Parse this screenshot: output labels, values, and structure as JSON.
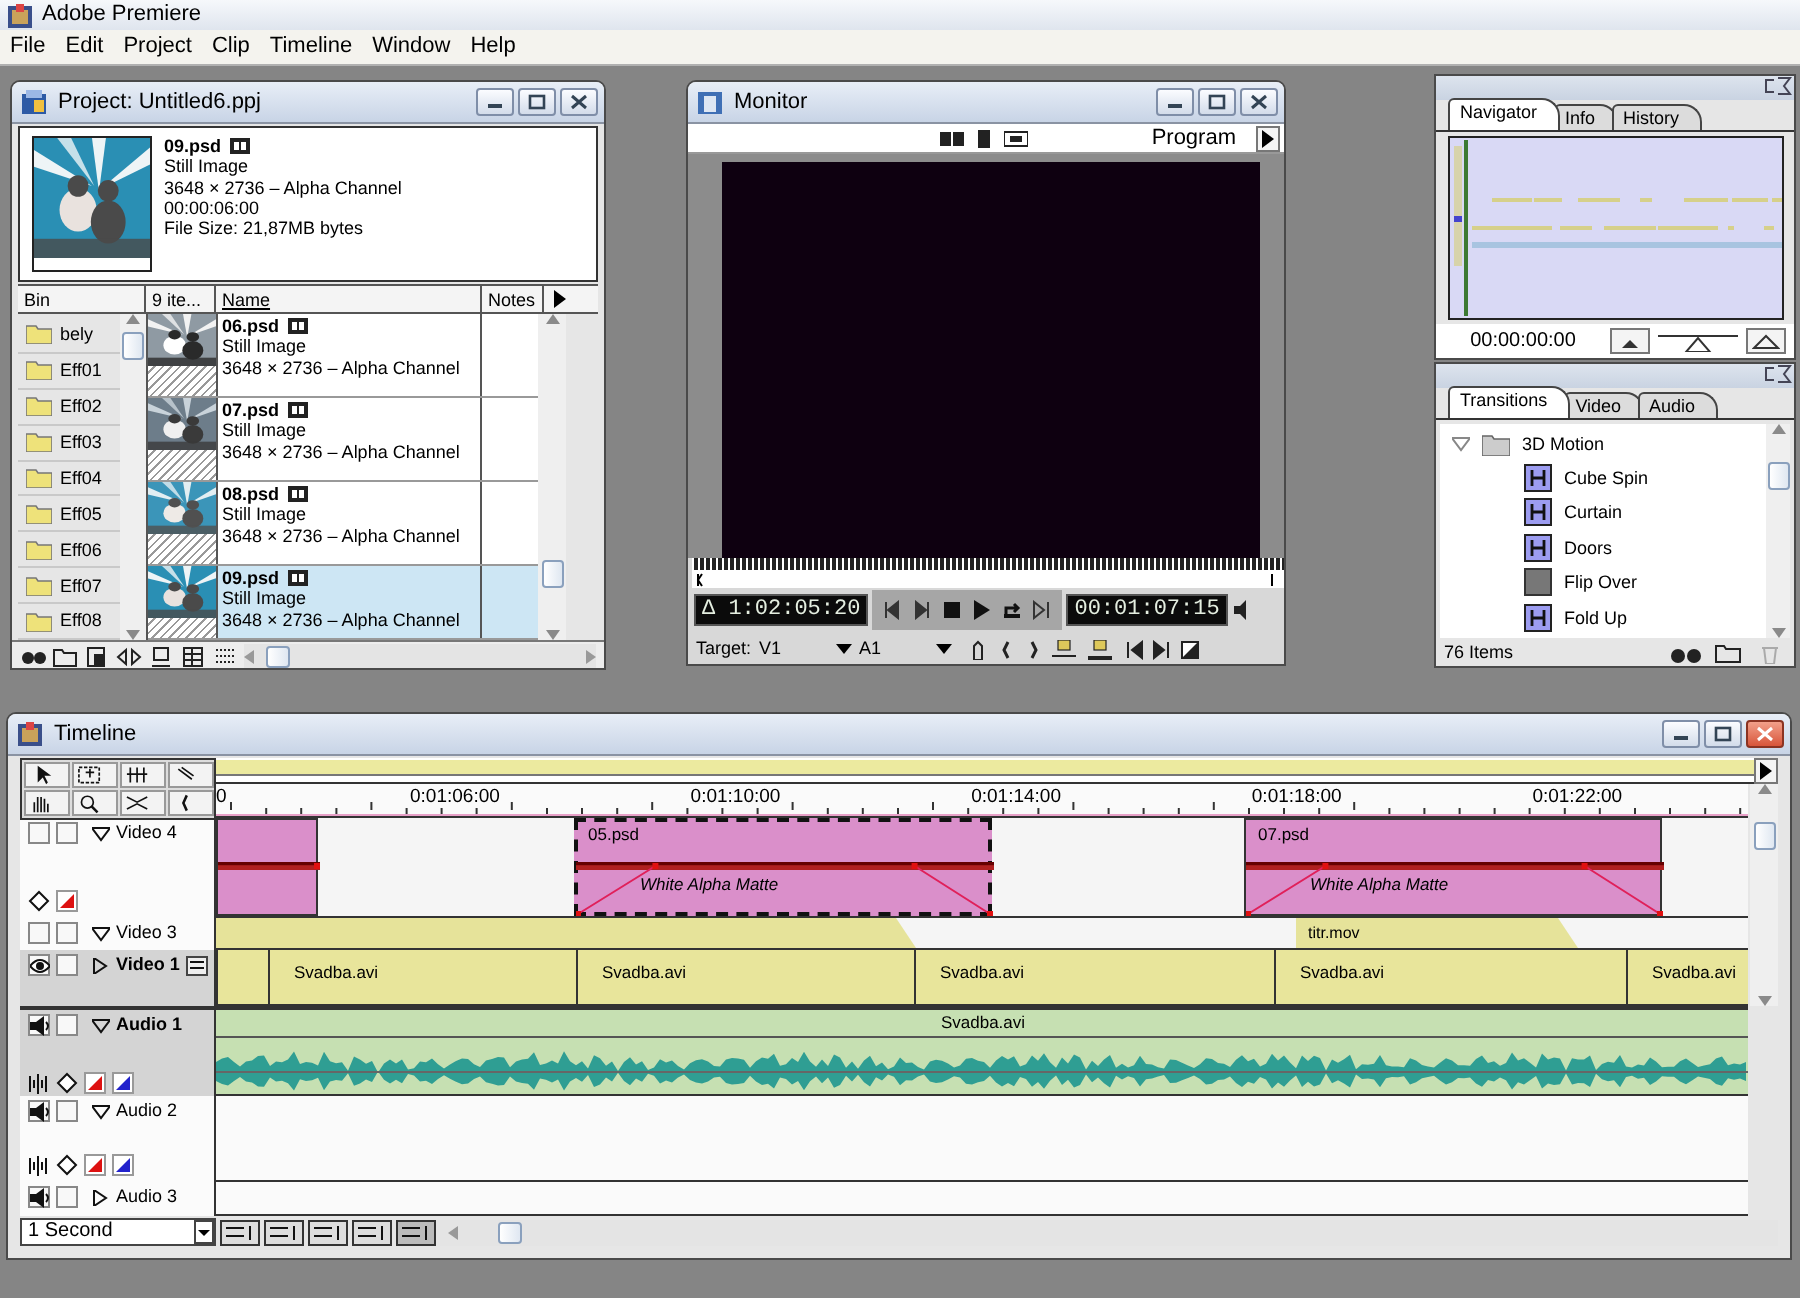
{
  "app": {
    "title": "Adobe Premiere",
    "menu": [
      "File",
      "Edit",
      "Project",
      "Clip",
      "Timeline",
      "Window",
      "Help"
    ]
  },
  "project": {
    "title": "Project: Untitled6.ppj",
    "preview": {
      "name": "09.psd",
      "lines": [
        "Still Image",
        "3648 × 2736 – Alpha Channel",
        "00:00:06:00",
        "File Size: 21,87MB bytes"
      ]
    },
    "columns": [
      "Bin",
      "9 ite...",
      "Name",
      "Notes"
    ],
    "bins": [
      "bely",
      "Eff01",
      "Eff02",
      "Eff03",
      "Eff04",
      "Eff05",
      "Eff06",
      "Eff07",
      "Eff08"
    ],
    "clips": [
      {
        "name": "06.psd",
        "type": "Still Image",
        "size": "3648 × 2736 – Alpha Channel",
        "selected": false
      },
      {
        "name": "07.psd",
        "type": "Still Image",
        "size": "3648 × 2736 – Alpha Channel",
        "selected": false
      },
      {
        "name": "08.psd",
        "type": "Still Image",
        "size": "3648 × 2736 – Alpha Channel",
        "selected": false
      },
      {
        "name": "09.psd",
        "type": "Still Image",
        "size": "3648 × 2736 – Alpha Channel",
        "selected": true
      }
    ]
  },
  "monitor": {
    "title": "Monitor",
    "view": "Program",
    "duration": "Δ 1:02:05:20",
    "timecode": "00:01:07:15",
    "target_label": "Target:",
    "video_target": "V1",
    "audio_target": "A1"
  },
  "navigator": {
    "tabs": [
      {
        "label": "Navigator",
        "selected": true
      },
      {
        "label": "Info",
        "selected": false
      },
      {
        "label": "History",
        "selected": false
      }
    ],
    "timecode": "00:00:00:00"
  },
  "effects": {
    "tabs": [
      {
        "label": "Transitions",
        "selected": true
      },
      {
        "label": "Video",
        "selected": false
      },
      {
        "label": "Audio",
        "selected": false
      }
    ],
    "folder": {
      "label": "3D Motion",
      "expanded": true,
      "children": [
        {
          "label": "Cube Spin"
        },
        {
          "label": "Curtain"
        },
        {
          "label": "Doors"
        },
        {
          "label": "Flip Over"
        },
        {
          "label": "Fold Up"
        }
      ]
    },
    "count": "76 Items"
  },
  "timeline": {
    "title": "Timeline",
    "ruler": [
      "0",
      "0:01:06:00",
      "0:01:10:00",
      "0:01:14:00",
      "0:01:18:00",
      "0:01:22:00"
    ],
    "tracks": [
      {
        "name": "Video 4",
        "kind": "video",
        "expanded": true,
        "enabled": false,
        "target": false,
        "clips": [
          {
            "kind": "matte",
            "selected": false
          },
          {
            "kind": "matte",
            "name": "05.psd",
            "effect": "White Alpha Matte",
            "selected": true
          },
          {
            "kind": "matte",
            "name": "07.psd",
            "effect": "White Alpha Matte",
            "selected": false
          }
        ]
      },
      {
        "name": "Video 3",
        "kind": "video",
        "expanded": true,
        "enabled": false,
        "target": false,
        "clips": [
          {
            "kind": "title",
            "selected": false
          },
          {
            "kind": "title",
            "name": "titr.mov",
            "selected": false
          }
        ]
      },
      {
        "name": "Video 1",
        "kind": "video",
        "expanded": false,
        "enabled": true,
        "target": true,
        "clips": [
          {
            "kind": "video",
            "selected": false
          },
          {
            "kind": "video",
            "name": "Svadba.avi",
            "selected": false
          },
          {
            "kind": "video",
            "name": "Svadba.avi",
            "selected": false
          },
          {
            "kind": "video",
            "name": "Svadba.avi",
            "selected": false
          },
          {
            "kind": "video",
            "name": "Svadba.avi",
            "selected": false
          },
          {
            "kind": "video",
            "name": "Svadba.avi",
            "selected": false
          }
        ]
      },
      {
        "name": "Audio 1",
        "kind": "audio",
        "expanded": true,
        "enabled": true,
        "target": true,
        "clips": [
          {
            "kind": "audio",
            "name": "Svadba.avi",
            "selected": false
          }
        ]
      },
      {
        "name": "Audio 2",
        "kind": "audio",
        "expanded": true,
        "enabled": true,
        "target": false
      },
      {
        "name": "Audio 3",
        "kind": "audio",
        "expanded": false,
        "enabled": true,
        "target": false
      }
    ],
    "zoom": "1 Second"
  }
}
